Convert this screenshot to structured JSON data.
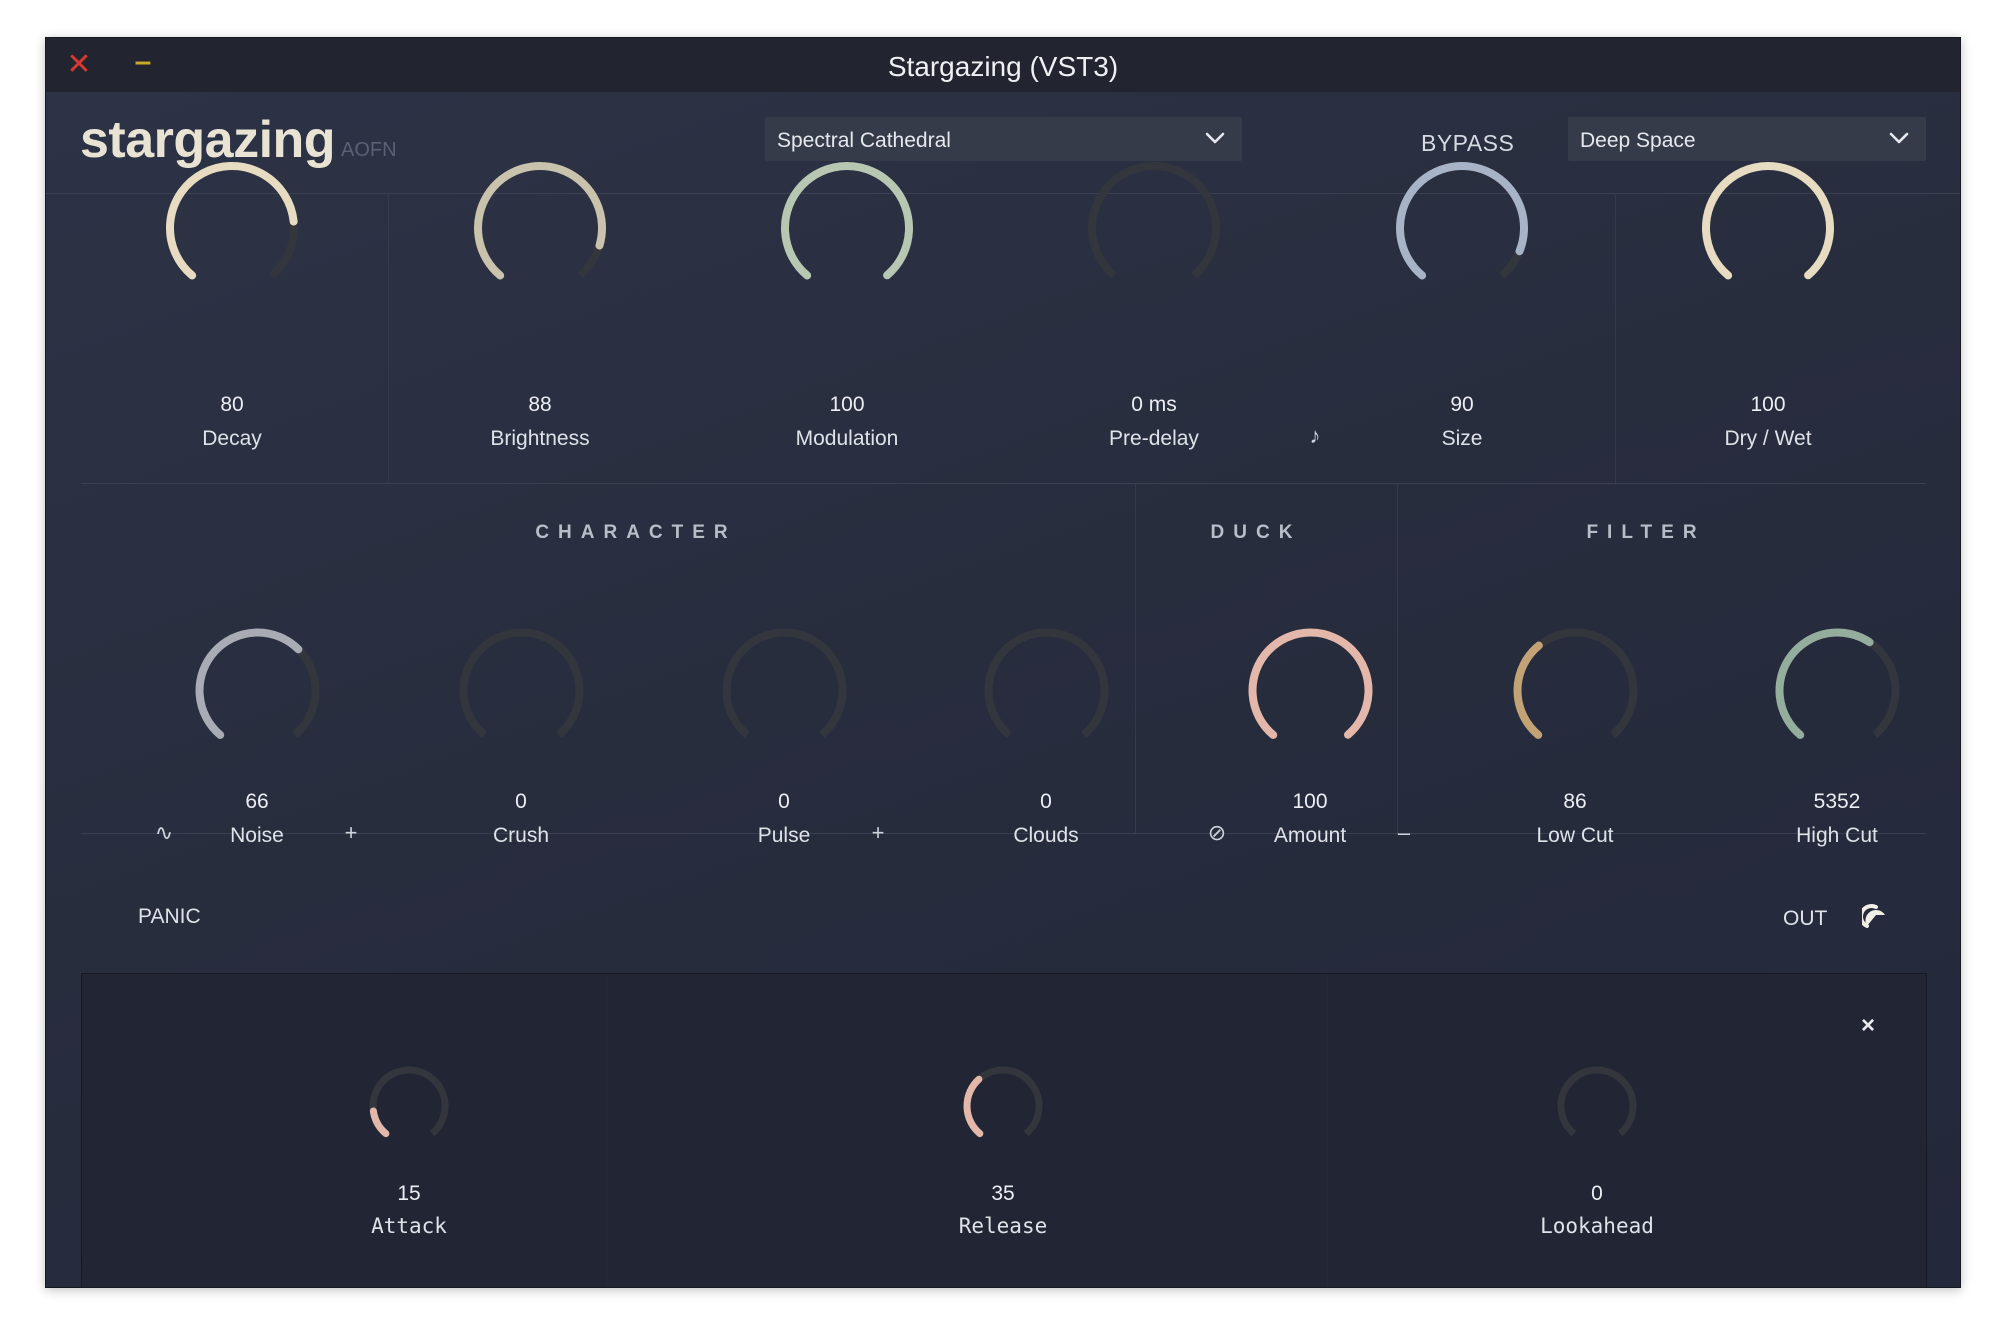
{
  "window": {
    "title": "Stargazing (VST3)",
    "close_glyph": "✕",
    "minimize_glyph": "–"
  },
  "header": {
    "logo": "stargazing",
    "logo_sub": "AOFN",
    "preset": "Spectral Cathedral",
    "bypass_label": "BYPASS",
    "mode": "Deep Space"
  },
  "colors": {
    "cream": "#e7dcc1",
    "beige": "#c9c2ac",
    "sage": "#b7c7b2",
    "blue_grey": "#a7b3c6",
    "silver": "#a9acb4",
    "pink": "#e3b7a9",
    "tan": "#c3a276",
    "green_grey": "#95ad9c",
    "track": "#34363d"
  },
  "top_knobs": [
    {
      "value": "80",
      "label": "Decay",
      "fraction": 0.8,
      "color": "#e7dcc1"
    },
    {
      "value": "88",
      "label": "Brightness",
      "fraction": 0.88,
      "color": "#c9c2ac"
    },
    {
      "value": "100",
      "label": "Modulation",
      "fraction": 1.0,
      "color": "#b7c7b2"
    },
    {
      "value": "0 ms",
      "label": "Pre-delay",
      "fraction": 0.0,
      "color": "#c9c2ac",
      "icon": "♪"
    },
    {
      "value": "90",
      "label": "Size",
      "fraction": 0.9,
      "color": "#a7b3c6"
    },
    {
      "value": "100",
      "label": "Dry / Wet",
      "fraction": 1.0,
      "color": "#e7dcc1"
    }
  ],
  "sections": {
    "character": "CHARACTER",
    "duck": "DUCK",
    "filter": "FILTER"
  },
  "mid_knobs": [
    {
      "value": "66",
      "label": "Noise",
      "fraction": 0.66,
      "color": "#a9acb4",
      "left_icon": "∿",
      "right_icon": "+"
    },
    {
      "value": "0",
      "label": "Crush",
      "fraction": 0.0,
      "color": "#a9acb4"
    },
    {
      "value": "0",
      "label": "Pulse",
      "fraction": 0.0,
      "color": "#a9acb4",
      "right_icon": "+"
    },
    {
      "value": "0",
      "label": "Clouds",
      "fraction": 0.0,
      "color": "#a9acb4"
    },
    {
      "value": "100",
      "label": "Amount",
      "fraction": 1.0,
      "color": "#e3b7a9",
      "left_icon": "⊘",
      "right_icon": "–"
    },
    {
      "value": "86",
      "label": "Low Cut",
      "fraction": 0.36,
      "color": "#c3a276"
    },
    {
      "value": "5352",
      "label": "High Cut",
      "fraction": 0.62,
      "color": "#95ad9c"
    }
  ],
  "footer": {
    "panic": "PANIC",
    "out": "OUT"
  },
  "panel": {
    "close_glyph": "×",
    "knobs": [
      {
        "value": "15",
        "label": "Attack",
        "fraction": 0.15,
        "color": "#e3b7a9"
      },
      {
        "value": "35",
        "label": "Release",
        "fraction": 0.35,
        "color": "#e3b7a9"
      },
      {
        "value": "0",
        "label": "Lookahead",
        "fraction": 0.0,
        "color": "#e3b7a9"
      }
    ]
  }
}
